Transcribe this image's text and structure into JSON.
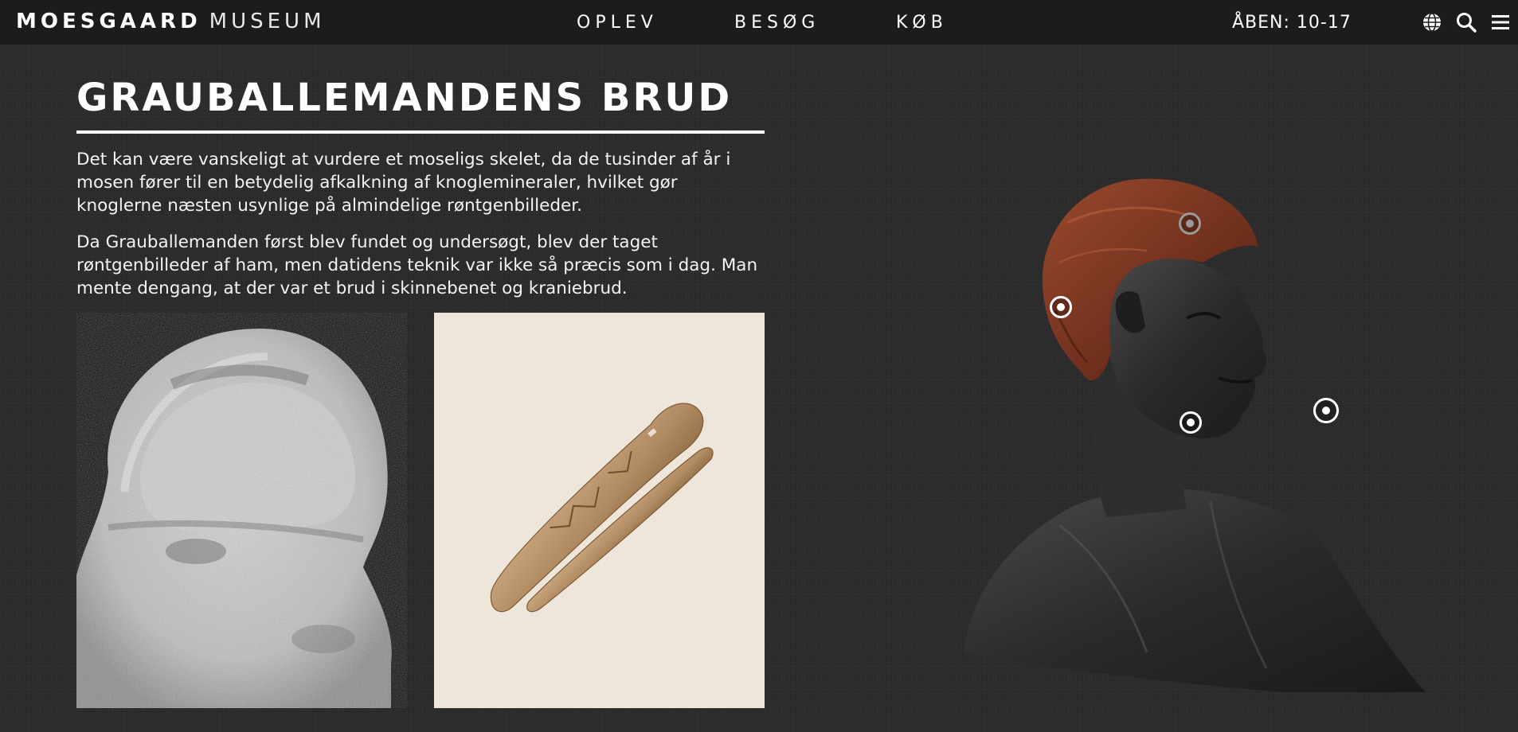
{
  "header": {
    "logo_bold": "MOESGAARD",
    "logo_light": "MUSEUM",
    "nav": [
      "OPLEV",
      "BESØG",
      "KØB"
    ],
    "hours": "ÅBEN: 10-17",
    "icons": [
      "globe-icon",
      "search-icon",
      "menu-icon"
    ]
  },
  "article": {
    "title": "GRAUBALLEMANDENS BRUD",
    "paragraphs": [
      "Det kan være vanskeligt at vurdere et moseligs skelet, da de tusinder af år i mosen fører til en betydelig afkalkning af knoglemineraler, hvilket gør knoglerne næsten usynlige på almindelige røntgenbilleder.",
      "Da Grauballemanden først blev fundet og undersøgt, blev der taget røntgenbilleder af ham, men datidens teknik var ikke så præcis som i dag. Man mente dengang, at der var et brud i skinnebenet og kraniebrud."
    ]
  },
  "colors": {
    "background": "#2b2b2b",
    "topbar": "#1c1c1c",
    "text": "#ffffff",
    "bone_model": "#b8946a",
    "image_bg": "#efe6db",
    "hair": "#7a3522"
  }
}
